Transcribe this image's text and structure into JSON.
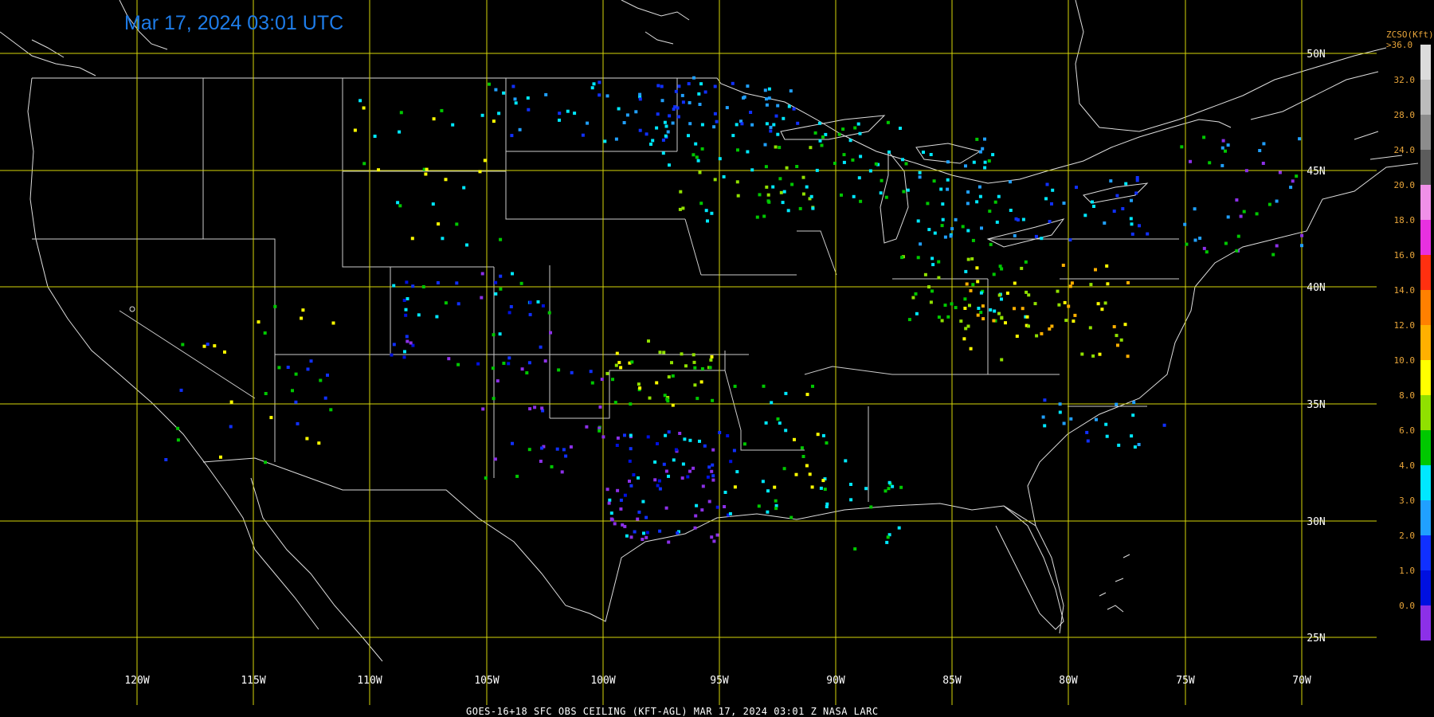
{
  "timestamp": "Mar 17, 2024 03:01 UTC",
  "footer": "GOES-16+18  SFC OBS CEILING (KFT-AGL)  MAR 17, 2024 03:01 Z   NASA LARC",
  "colors": {
    "background": "#000000",
    "grid": "#d6d60a",
    "border": "#dddddd",
    "timestamp": "#1e7ce8",
    "scale_text": "#e8a53a"
  },
  "lon_labels": [
    "120W",
    "115W",
    "110W",
    "105W",
    "100W",
    "95W",
    "90W",
    "85W",
    "80W",
    "75W",
    "70W"
  ],
  "lat_labels": [
    "50N",
    "45N",
    "40N",
    "35N",
    "30N",
    "25N"
  ],
  "color_scale": {
    "title": "ZCSO(Kft)",
    "top_label": ">36.0",
    "levels": [
      {
        "label": "32.0",
        "color": "#bcbcbc"
      },
      {
        "label": "28.0",
        "color": "#8c8c8c"
      },
      {
        "label": "24.0",
        "color": "#5c5c5c"
      },
      {
        "label": "20.0",
        "color": "#f090e8"
      },
      {
        "label": "18.0",
        "color": "#e830e0"
      },
      {
        "label": "16.0",
        "color": "#ff3010"
      },
      {
        "label": "14.0",
        "color": "#ff8000"
      },
      {
        "label": "12.0",
        "color": "#ffb000"
      },
      {
        "label": "10.0",
        "color": "#ffff00"
      },
      {
        "label": "8.0",
        "color": "#90e000"
      },
      {
        "label": "6.0",
        "color": "#00c800"
      },
      {
        "label": "4.0",
        "color": "#00e8ff"
      },
      {
        "label": "3.0",
        "color": "#20a0ff"
      },
      {
        "label": "2.0",
        "color": "#1030ff"
      },
      {
        "label": "1.0",
        "color": "#0010e0"
      },
      {
        "label": "0.0",
        "color": "#8c30e8"
      }
    ]
  }
}
